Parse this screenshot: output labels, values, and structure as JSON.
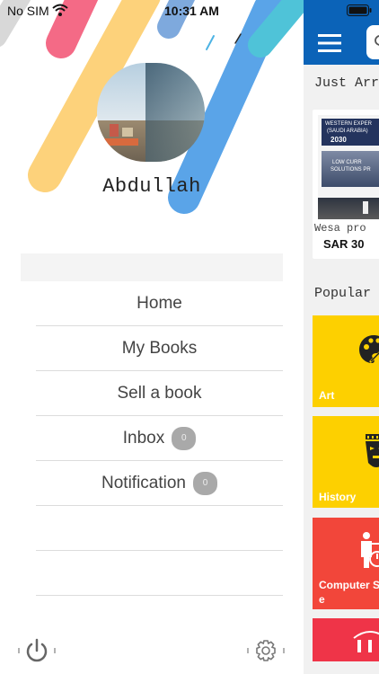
{
  "status_bar": {
    "carrier": "No SIM",
    "time": "10:31 AM"
  },
  "drawer": {
    "user_name": "Abdullah",
    "menu_items": [
      {
        "label": "Home"
      },
      {
        "label": "My Books"
      },
      {
        "label": "Sell a book"
      },
      {
        "label": "Inbox",
        "badge": "0"
      },
      {
        "label": "Notification",
        "badge": "0"
      }
    ],
    "icons": {
      "logout": "power-icon",
      "settings": "gear-icon"
    }
  },
  "main": {
    "header_color": "#0b63b8",
    "sections": {
      "just_arrived": "Just Arr",
      "popular": "Popular"
    },
    "book": {
      "cover_lines": [
        "WESTERN EXPER",
        "(SAUDI ARABIA)",
        "2030",
        "LOW CURR",
        "SOLUTIONS PR"
      ],
      "title": "Wesa pro",
      "price": "SAR 30"
    },
    "categories": [
      {
        "label": "Art",
        "color": "#fdd000"
      },
      {
        "label": "History",
        "color": "#fdd000"
      },
      {
        "label": "Computer S",
        "label_line2": "e",
        "color": "#f2463a"
      },
      {
        "label": "",
        "color": "#ef3448"
      }
    ]
  }
}
